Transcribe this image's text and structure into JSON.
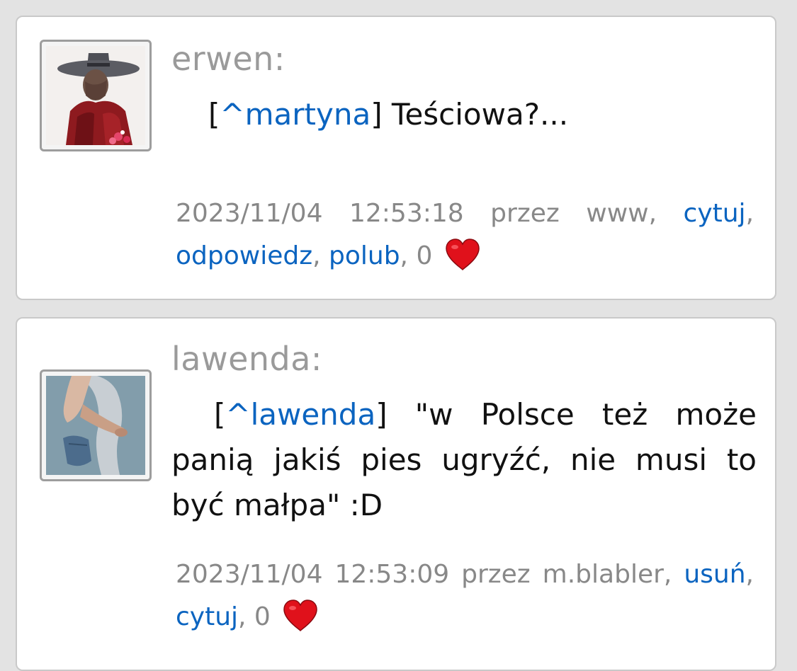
{
  "posts": [
    {
      "author": "erwen:",
      "avatar_icon": "old-woman-in-hat-avatar",
      "body": {
        "open_bracket": "[",
        "mention": "^martyna",
        "close_bracket": "]",
        "text": " Teściowa?..."
      },
      "meta": {
        "timestamp": "2023/11/04 12:53:18",
        "via": "przez www,",
        "actions": [
          "cytuj",
          "odpowiedz",
          "polub"
        ],
        "likes": "0",
        "heart_color": "#e0111b"
      }
    },
    {
      "author": "lawenda:",
      "avatar_icon": "figure-photo-avatar",
      "body": {
        "open_bracket": "[",
        "mention": "^lawenda",
        "close_bracket": "]",
        "text": " \"w Polsce też może panią jakiś pies ugryźć, nie musi to być małpa\" :D"
      },
      "meta": {
        "timestamp": "2023/11/04 12:53:09",
        "via": "przez m.blabler,",
        "actions": [
          "usuń",
          "cytuj"
        ],
        "likes": "0",
        "heart_color": "#e0111b"
      }
    }
  ],
  "colors": {
    "background": "#e3e3e3",
    "card": "#ffffff",
    "link": "#0b64c0",
    "author": "#9a9a9a",
    "meta": "#888888"
  }
}
